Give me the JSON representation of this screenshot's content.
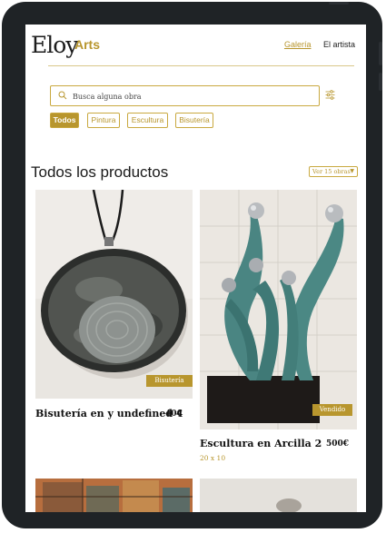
{
  "header": {
    "logo_main": "Eloy",
    "logo_sub": "Arts",
    "nav": [
      {
        "label": "Galería",
        "active": true
      },
      {
        "label": "El artista",
        "active": false
      }
    ]
  },
  "search": {
    "placeholder": "Busca alguna obra"
  },
  "categories": [
    {
      "label": "Todos",
      "active": true
    },
    {
      "label": "Pintura",
      "active": false
    },
    {
      "label": "Escultura",
      "active": false
    },
    {
      "label": "Bisutería",
      "active": false
    }
  ],
  "section_title": "Todos los productos",
  "count_select": {
    "value": "Ver 15 obras"
  },
  "products": [
    {
      "badge": "Bisutería",
      "name": "Bisutería en y undefined 4",
      "price": "40€",
      "dimensions": ""
    },
    {
      "badge": "Vendido",
      "name": "Escultura en Arcilla 2",
      "price": "500€",
      "dimensions": "20 x 10"
    }
  ],
  "colors": {
    "accent": "#b8962e",
    "frame": "#1f2326"
  }
}
